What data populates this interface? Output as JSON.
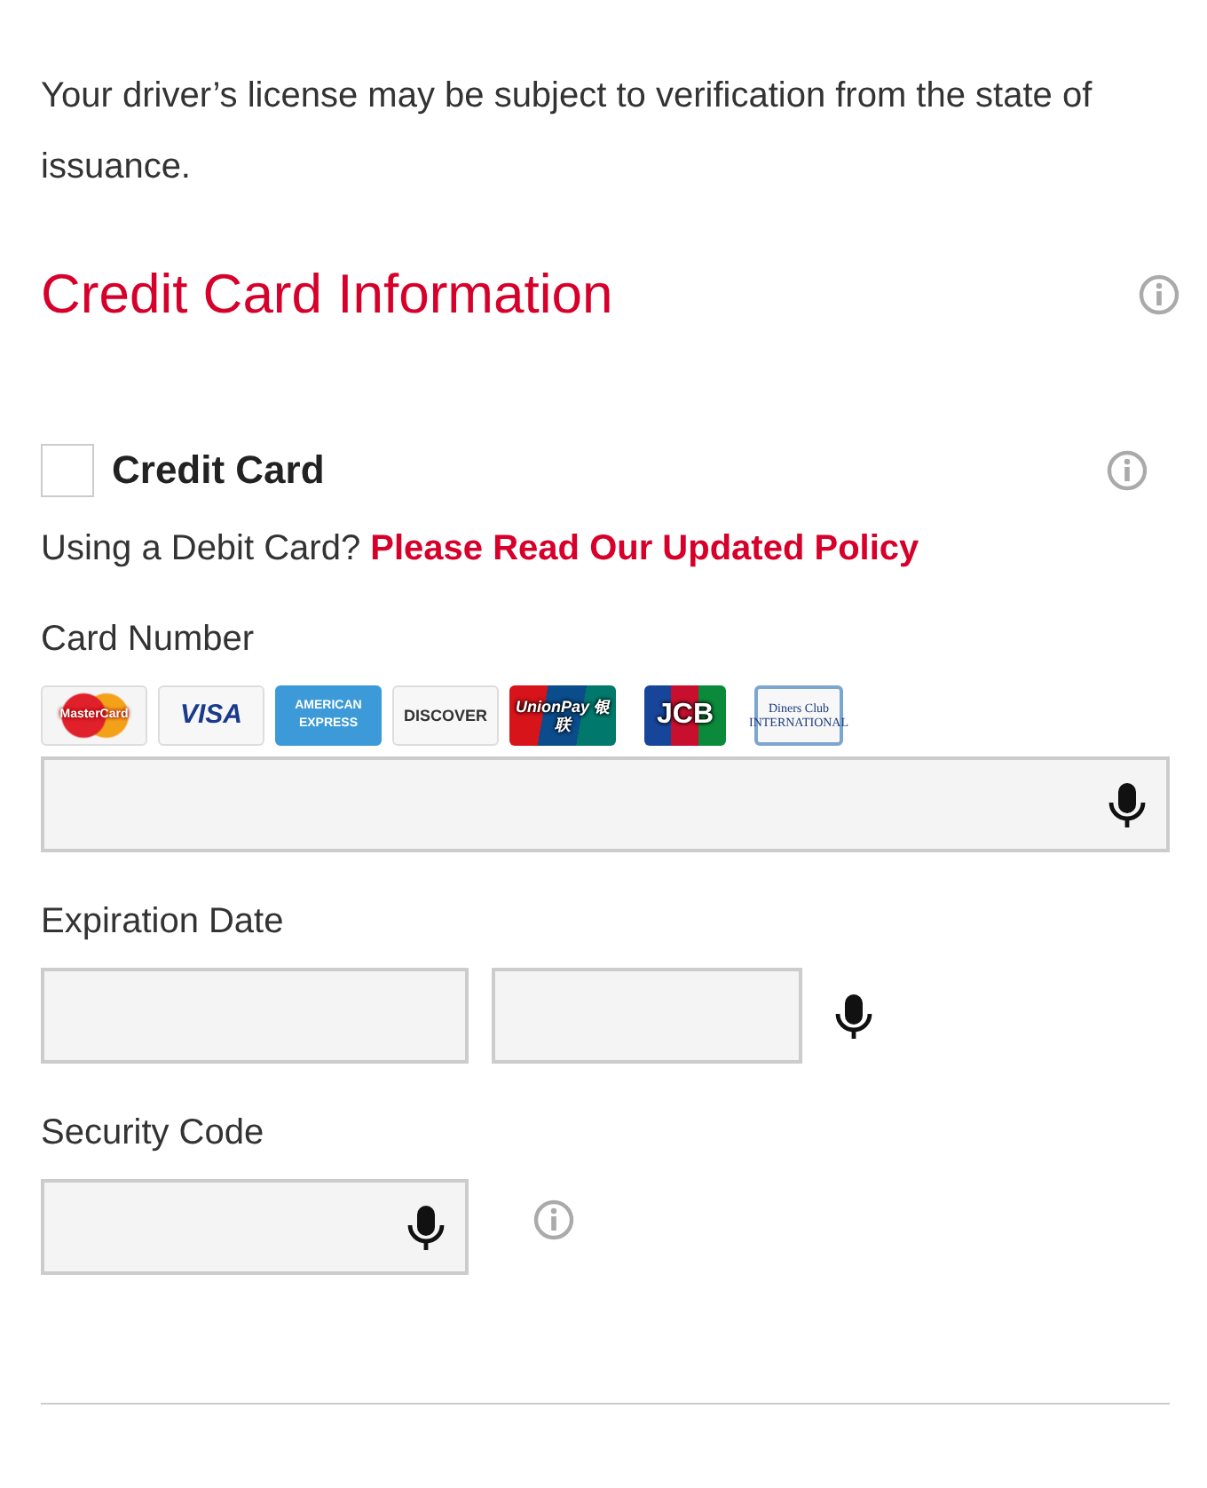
{
  "notice": "Your driver’s license may be subject to verification from the state of issuance.",
  "section_title": "Credit Card Information",
  "credit_card_option": {
    "label": "Credit Card",
    "checked": false
  },
  "debit_notice": {
    "text": "Using a Debit Card?",
    "link": "Please Read Our Updated Policy"
  },
  "card_number": {
    "label": "Card Number",
    "brands": [
      {
        "kind": "mastercard",
        "text": "MasterCard"
      },
      {
        "kind": "visa",
        "text": "VISA"
      },
      {
        "kind": "amex",
        "text": "AMERICAN EXPRESS"
      },
      {
        "kind": "discover",
        "text": "DISCOVER"
      },
      {
        "kind": "unionpay",
        "text": "UnionPay 银联"
      },
      {
        "kind": "jcb",
        "text": "JCB"
      },
      {
        "kind": "diners",
        "text": "Diners Club INTERNATIONAL"
      }
    ]
  },
  "expiration": {
    "label": "Expiration Date"
  },
  "security_code": {
    "label": "Security Code"
  }
}
